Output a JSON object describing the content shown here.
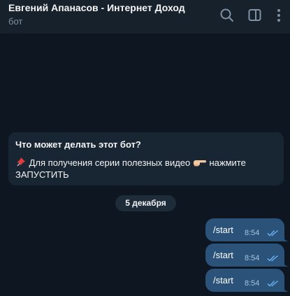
{
  "header": {
    "title": "Евгений Апанасов - Интернет Доход",
    "subtitle": "бот"
  },
  "intro": {
    "title": "Что может делать этот бот?",
    "line1": "Для получения серии полезных видео",
    "line1_suffix": "нажмите",
    "line2": "ЗАПУСТИТЬ"
  },
  "date_separator": "5 декабря",
  "messages": [
    {
      "text": "/start",
      "time": "8:54",
      "status": "read"
    },
    {
      "text": "/start",
      "time": "8:54",
      "status": "read"
    },
    {
      "text": "/start",
      "time": "8:54",
      "status": "read"
    }
  ],
  "icons": {
    "header": [
      "search-icon",
      "sidebar-toggle-icon",
      "more-vertical-icon"
    ],
    "intro": [
      "pushpin-icon",
      "pointing-hand-icon"
    ],
    "message_status": "double-check-icon"
  },
  "colors": {
    "background": "#0e1621",
    "header": "#17212b",
    "incoming_card": "#182533",
    "outgoing_bubble": "#2b5278",
    "subtitle": "#7f91a4",
    "check": "#6ab3f3"
  }
}
